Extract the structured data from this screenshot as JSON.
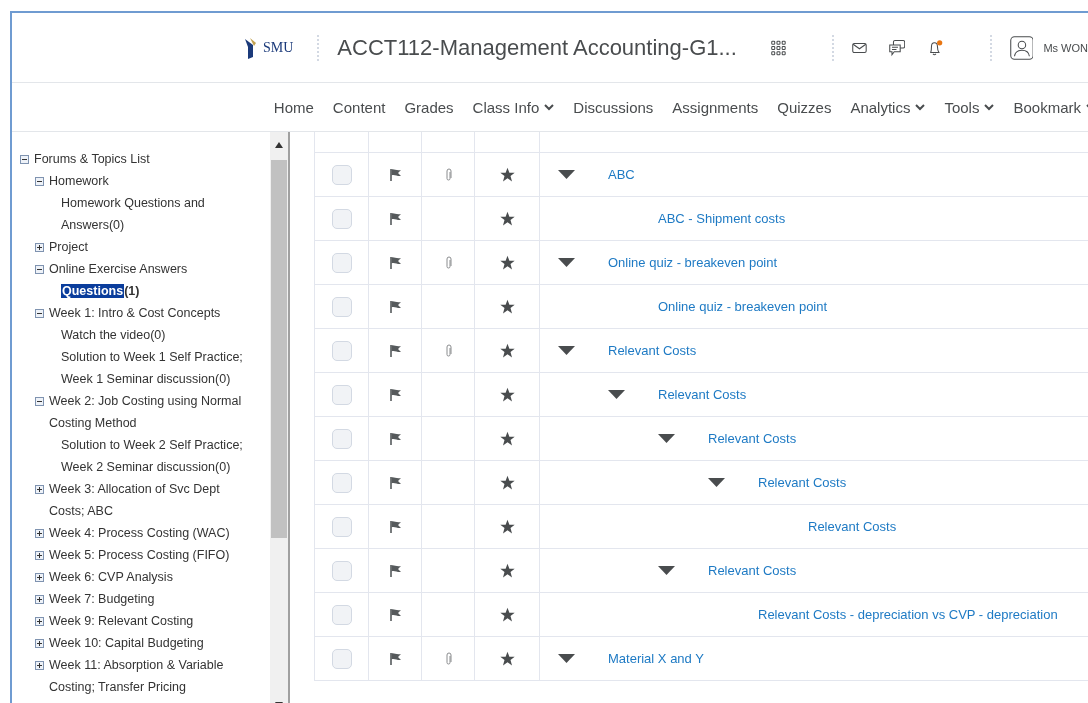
{
  "header": {
    "logo": "SMU",
    "course_title": "ACCT112-Management Accounting-G1...",
    "user_name": "Ms WON"
  },
  "nav": [
    {
      "label": "Home",
      "dropdown": false
    },
    {
      "label": "Content",
      "dropdown": false
    },
    {
      "label": "Grades",
      "dropdown": false
    },
    {
      "label": "Class Info",
      "dropdown": true
    },
    {
      "label": "Discussions",
      "dropdown": false
    },
    {
      "label": "Assignments",
      "dropdown": false
    },
    {
      "label": "Quizzes",
      "dropdown": false
    },
    {
      "label": "Analytics",
      "dropdown": true
    },
    {
      "label": "Tools",
      "dropdown": true
    },
    {
      "label": "Bookmark",
      "dropdown": true
    }
  ],
  "sidebar": {
    "tree": [
      {
        "label": "Forums & Topics List",
        "expanded": true,
        "children": [
          {
            "label": "Homework",
            "expanded": true,
            "children": [
              {
                "label": "Homework Questions and Answers",
                "count": "(0)",
                "selected": false
              }
            ]
          },
          {
            "label": "Project",
            "expanded": false
          },
          {
            "label": "Online Exercise Answers",
            "expanded": true,
            "children": [
              {
                "label": "Questions",
                "count": "(1)",
                "selected": true
              }
            ]
          },
          {
            "label": "Week 1: Intro & Cost Concepts",
            "expanded": true,
            "children": [
              {
                "label": "Watch the video",
                "count": "(0)",
                "selected": false
              },
              {
                "label": "Solution to Week 1 Self Practice; Week 1 Seminar discussion",
                "count": "(0)",
                "selected": false
              }
            ]
          },
          {
            "label": "Week 2: Job Costing using Normal Costing Method",
            "expanded": true,
            "children": [
              {
                "label": "Solution to Week 2 Self Practice; Week 2 Seminar discussion",
                "count": "(0)",
                "selected": false
              }
            ]
          },
          {
            "label": "Week 3: Allocation of Svc Dept Costs; ABC",
            "expanded": false
          },
          {
            "label": "Week 4: Process Costing (WAC)",
            "expanded": false
          },
          {
            "label": "Week 5: Process Costing (FIFO)",
            "expanded": false
          },
          {
            "label": "Week 6: CVP Analysis",
            "expanded": false
          },
          {
            "label": "Week 7: Budgeting",
            "expanded": false
          },
          {
            "label": "Week 9: Relevant Costing",
            "expanded": false
          },
          {
            "label": "Week 10: Capital Budgeting",
            "expanded": false
          },
          {
            "label": "Week 11: Absorption & Variable Costing; Transfer Pricing",
            "expanded": false
          }
        ]
      }
    ]
  },
  "threads": [
    {
      "subject": "ABC",
      "checked": false,
      "attachment": true,
      "expanded": true,
      "children": [
        {
          "subject": "ABC - Shipment costs",
          "checked": false,
          "attachment": false
        }
      ]
    },
    {
      "subject": "Online quiz - breakeven point",
      "checked": false,
      "attachment": true,
      "expanded": true,
      "children": [
        {
          "subject": "Online quiz - breakeven point",
          "checked": false,
          "attachment": false
        }
      ]
    },
    {
      "subject": "Relevant Costs",
      "checked": false,
      "attachment": true,
      "expanded": true,
      "children": [
        {
          "subject": "Relevant Costs",
          "checked": false,
          "attachment": false,
          "expanded": true,
          "children": [
            {
              "subject": "Relevant Costs",
              "checked": false,
              "attachment": false,
              "expanded": true,
              "children": [
                {
                  "subject": "Relevant Costs",
                  "checked": false,
                  "attachment": false,
                  "expanded": true,
                  "children": [
                    {
                      "subject": "Relevant Costs",
                      "checked": false,
                      "attachment": false
                    }
                  ]
                }
              ]
            },
            {
              "subject": "Relevant Costs",
              "checked": false,
              "attachment": false,
              "expanded": true,
              "children": [
                {
                  "subject": "Relevant Costs - depreciation vs CVP - depreciation",
                  "checked": false,
                  "attachment": false
                }
              ]
            }
          ]
        }
      ]
    },
    {
      "subject": "Material X and Y",
      "checked": false,
      "attachment": true,
      "expanded": true
    }
  ]
}
